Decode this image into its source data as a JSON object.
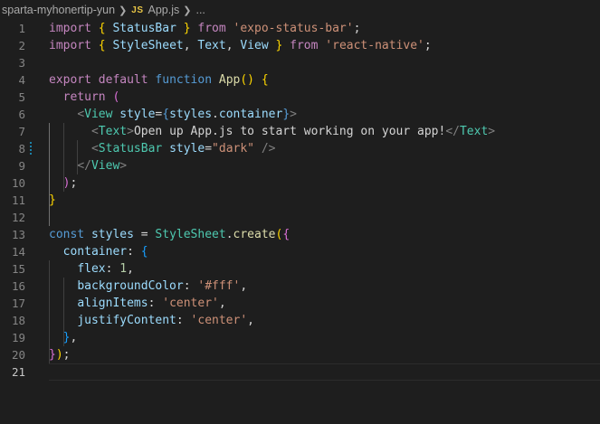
{
  "breadcrumb": {
    "folder": "sparta-myhonertip-yun",
    "file_icon": "JS",
    "file": "App.js",
    "more": "..."
  },
  "editor": {
    "active_line": 21,
    "modified_line": 8,
    "lines": [
      {
        "n": "1",
        "tokens": [
          [
            "k",
            "import"
          ],
          [
            "p",
            " "
          ],
          [
            "y",
            "{"
          ],
          [
            "p",
            " "
          ],
          [
            "v",
            "StatusBar"
          ],
          [
            "p",
            " "
          ],
          [
            "y",
            "}"
          ],
          [
            "p",
            " "
          ],
          [
            "k",
            "from"
          ],
          [
            "p",
            " "
          ],
          [
            "s",
            "'expo-status-bar'"
          ],
          [
            "p",
            ";"
          ]
        ]
      },
      {
        "n": "2",
        "tokens": [
          [
            "k",
            "import"
          ],
          [
            "p",
            " "
          ],
          [
            "y",
            "{"
          ],
          [
            "p",
            " "
          ],
          [
            "v",
            "StyleSheet"
          ],
          [
            "p",
            ", "
          ],
          [
            "v",
            "Text"
          ],
          [
            "p",
            ", "
          ],
          [
            "v",
            "View"
          ],
          [
            "p",
            " "
          ],
          [
            "y",
            "}"
          ],
          [
            "p",
            " "
          ],
          [
            "k",
            "from"
          ],
          [
            "p",
            " "
          ],
          [
            "s",
            "'react-native'"
          ],
          [
            "p",
            ";"
          ]
        ]
      },
      {
        "n": "3",
        "tokens": []
      },
      {
        "n": "4",
        "tokens": [
          [
            "k",
            "export"
          ],
          [
            "p",
            " "
          ],
          [
            "k",
            "default"
          ],
          [
            "p",
            " "
          ],
          [
            "b",
            "function"
          ],
          [
            "p",
            " "
          ],
          [
            "f",
            "App"
          ],
          [
            "y",
            "()"
          ],
          [
            "p",
            " "
          ],
          [
            "y",
            "{"
          ]
        ]
      },
      {
        "n": "5",
        "tokens": [
          [
            "p",
            "  "
          ],
          [
            "k",
            "return"
          ],
          [
            "p",
            " "
          ],
          [
            "m",
            "("
          ]
        ]
      },
      {
        "n": "6",
        "tokens": [
          [
            "p",
            "    "
          ],
          [
            "g",
            "<"
          ],
          [
            "t",
            "View"
          ],
          [
            "p",
            " "
          ],
          [
            "v",
            "style"
          ],
          [
            "p",
            "="
          ],
          [
            "b",
            "{"
          ],
          [
            "v",
            "styles"
          ],
          [
            "p",
            "."
          ],
          [
            "v",
            "container"
          ],
          [
            "b",
            "}"
          ],
          [
            "g",
            ">"
          ]
        ]
      },
      {
        "n": "7",
        "tokens": [
          [
            "p",
            "      "
          ],
          [
            "g",
            "<"
          ],
          [
            "t",
            "Text"
          ],
          [
            "g",
            ">"
          ],
          [
            "p",
            "Open up App.js to start working on your app!"
          ],
          [
            "g",
            "</"
          ],
          [
            "t",
            "Text"
          ],
          [
            "g",
            ">"
          ]
        ]
      },
      {
        "n": "8",
        "tokens": [
          [
            "p",
            "      "
          ],
          [
            "g",
            "<"
          ],
          [
            "t",
            "StatusBar"
          ],
          [
            "p",
            " "
          ],
          [
            "v",
            "style"
          ],
          [
            "p",
            "="
          ],
          [
            "s",
            "\"dark\""
          ],
          [
            "p",
            " "
          ],
          [
            "g",
            "/>"
          ]
        ]
      },
      {
        "n": "9",
        "tokens": [
          [
            "p",
            "    "
          ],
          [
            "g",
            "</"
          ],
          [
            "t",
            "View"
          ],
          [
            "g",
            ">"
          ]
        ]
      },
      {
        "n": "10",
        "tokens": [
          [
            "p",
            "  "
          ],
          [
            "m",
            ")"
          ],
          [
            "p",
            ";"
          ]
        ]
      },
      {
        "n": "11",
        "tokens": [
          [
            "y",
            "}"
          ]
        ]
      },
      {
        "n": "12",
        "tokens": []
      },
      {
        "n": "13",
        "tokens": [
          [
            "b",
            "const"
          ],
          [
            "p",
            " "
          ],
          [
            "v",
            "styles"
          ],
          [
            "p",
            " = "
          ],
          [
            "t",
            "StyleSheet"
          ],
          [
            "p",
            "."
          ],
          [
            "f",
            "create"
          ],
          [
            "y",
            "("
          ],
          [
            "m",
            "{"
          ]
        ]
      },
      {
        "n": "14",
        "tokens": [
          [
            "p",
            "  "
          ],
          [
            "v",
            "container"
          ],
          [
            "p",
            ": "
          ],
          [
            "c",
            "{"
          ]
        ]
      },
      {
        "n": "15",
        "tokens": [
          [
            "p",
            "    "
          ],
          [
            "v",
            "flex"
          ],
          [
            "p",
            ": "
          ],
          [
            "n",
            "1"
          ],
          [
            "p",
            ","
          ]
        ]
      },
      {
        "n": "16",
        "tokens": [
          [
            "p",
            "    "
          ],
          [
            "v",
            "backgroundColor"
          ],
          [
            "p",
            ": "
          ],
          [
            "s",
            "'#fff'"
          ],
          [
            "p",
            ","
          ]
        ]
      },
      {
        "n": "17",
        "tokens": [
          [
            "p",
            "    "
          ],
          [
            "v",
            "alignItems"
          ],
          [
            "p",
            ": "
          ],
          [
            "s",
            "'center'"
          ],
          [
            "p",
            ","
          ]
        ]
      },
      {
        "n": "18",
        "tokens": [
          [
            "p",
            "    "
          ],
          [
            "v",
            "justifyContent"
          ],
          [
            "p",
            ": "
          ],
          [
            "s",
            "'center'"
          ],
          [
            "p",
            ","
          ]
        ]
      },
      {
        "n": "19",
        "tokens": [
          [
            "p",
            "  "
          ],
          [
            "c",
            "}"
          ],
          [
            "p",
            ","
          ]
        ]
      },
      {
        "n": "20",
        "tokens": [
          [
            "m",
            "}"
          ],
          [
            "y",
            ")"
          ],
          [
            "p",
            ";"
          ]
        ]
      },
      {
        "n": "21",
        "tokens": []
      }
    ]
  }
}
